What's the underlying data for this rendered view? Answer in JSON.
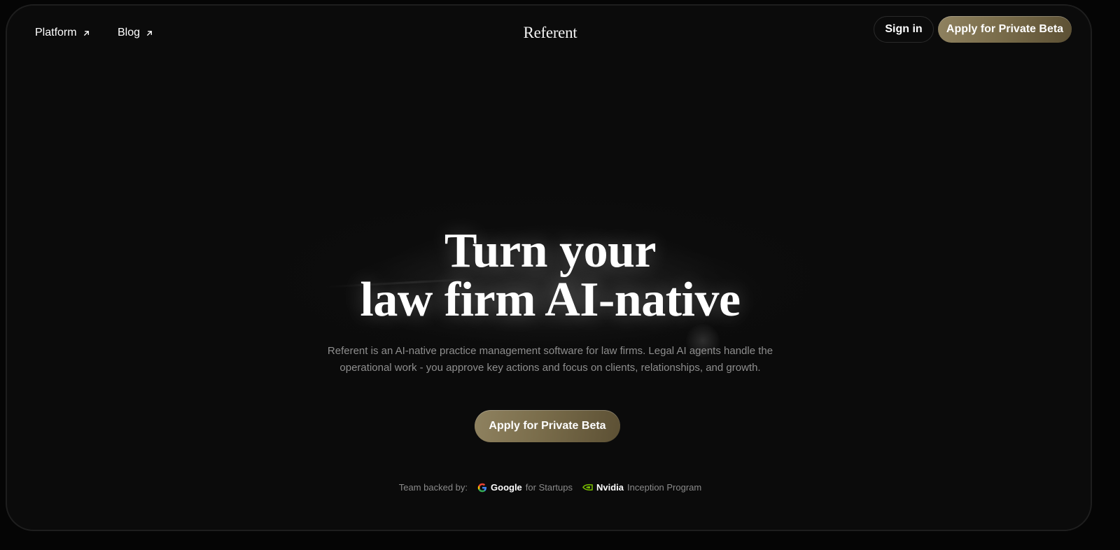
{
  "nav": {
    "platform_label": "Platform",
    "blog_label": "Blog",
    "logo_text": "Referent",
    "signin_label": "Sign in",
    "apply_label": "Apply for Private Beta",
    "external_icon": "arrow-up-right-icon"
  },
  "hero": {
    "headline_line1": "Turn your",
    "headline_line2": "law firm AI-native",
    "subtitle_line1": "Referent is an AI-native practice management software for law firms. Legal AI agents handle the",
    "subtitle_line2": "operational work - you approve key actions and focus on clients, relationships, and growth.",
    "cta_label": "Apply for Private Beta"
  },
  "backers": {
    "label": "Team backed by:",
    "google_brand": "Google",
    "google_suffix": "for Startups",
    "nvidia_brand": "Nvidia",
    "nvidia_suffix": "Inception Program"
  },
  "colors": {
    "background": "#0b0b0b",
    "accent_gold": "#8f8260",
    "text_muted": "#8e8e8e"
  }
}
